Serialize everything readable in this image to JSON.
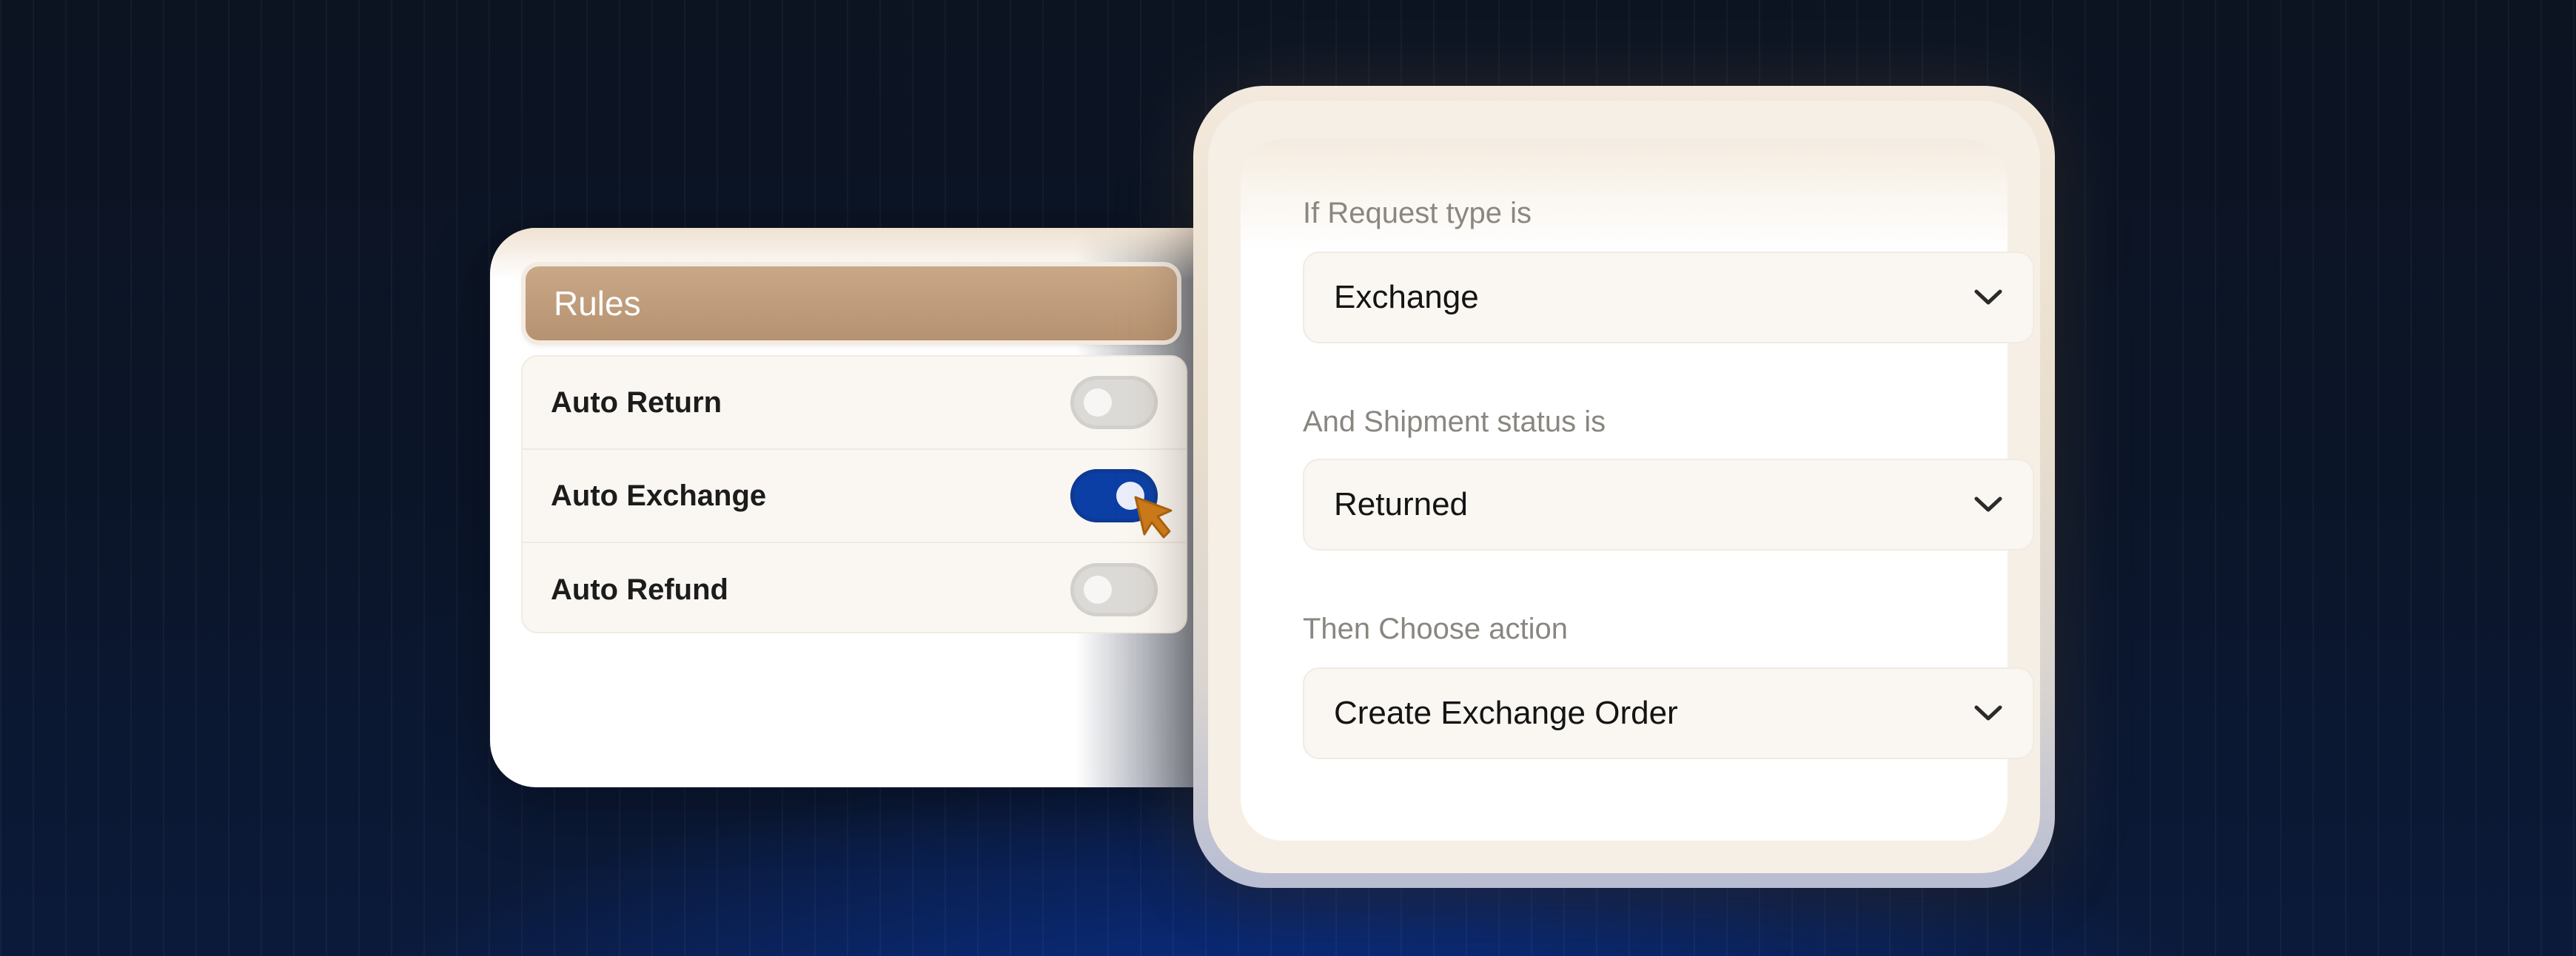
{
  "rules": {
    "title": "Rules",
    "items": [
      {
        "label": "Auto Return",
        "enabled": false
      },
      {
        "label": "Auto Exchange",
        "enabled": true
      },
      {
        "label": "Auto Refund",
        "enabled": false
      }
    ]
  },
  "conditions": {
    "request_type": {
      "label": "If Request type is",
      "value": "Exchange"
    },
    "shipment_status": {
      "label": "And Shipment status is",
      "value": "Returned"
    },
    "action": {
      "label": "Then Choose action",
      "value": "Create Exchange Order"
    }
  },
  "colors": {
    "toggle_on": "#0b3fa6",
    "header_bg": "#b69271",
    "cursor": "#c9781a"
  },
  "icons": {
    "dropdown": "chevron-down-icon",
    "cursor": "pointer-cursor-icon"
  }
}
